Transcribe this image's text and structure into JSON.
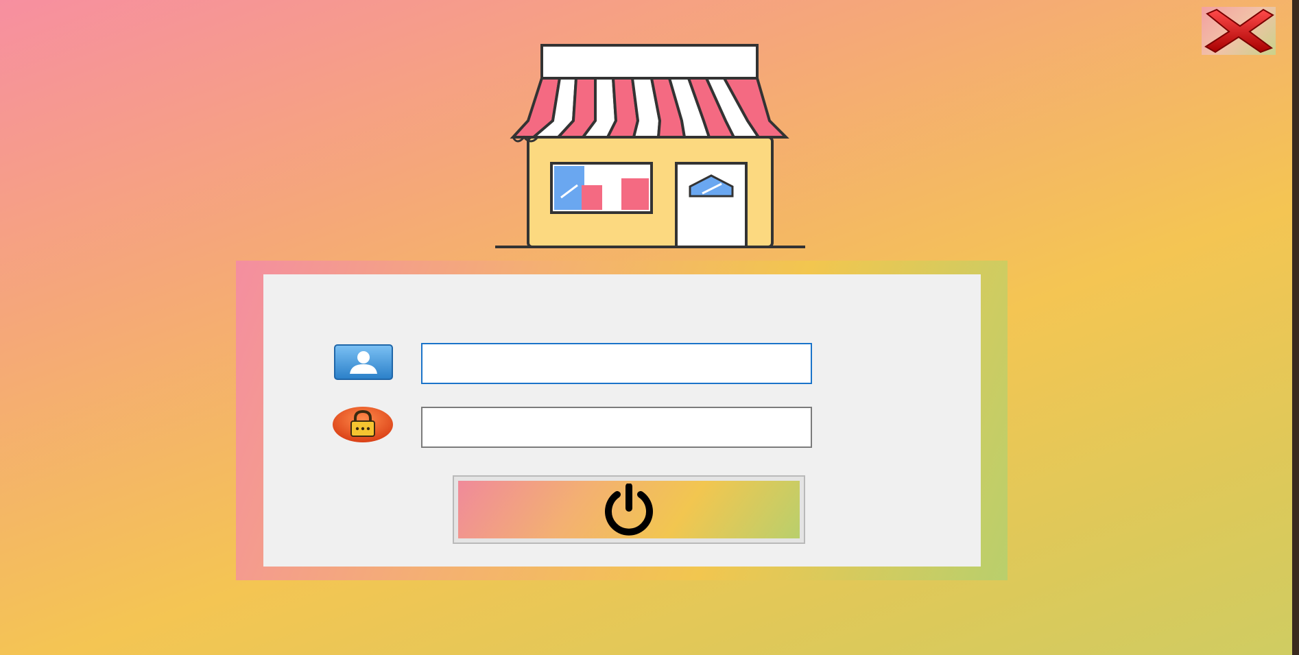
{
  "window": {
    "background_colors": [
      "#f78fa0",
      "#f5a878",
      "#f4c553",
      "#cfcc62"
    ]
  },
  "close_button": {
    "icon": "close-x-icon",
    "color": "#d11a1a"
  },
  "logo": {
    "icon": "shop-storefront-icon",
    "awning_colors": [
      "#f46a82",
      "#ffffff"
    ]
  },
  "login": {
    "username": {
      "icon": "user-icon",
      "value": "",
      "placeholder": ""
    },
    "password": {
      "icon": "lock-icon",
      "value": "",
      "placeholder": ""
    },
    "submit": {
      "icon": "power-icon"
    }
  }
}
